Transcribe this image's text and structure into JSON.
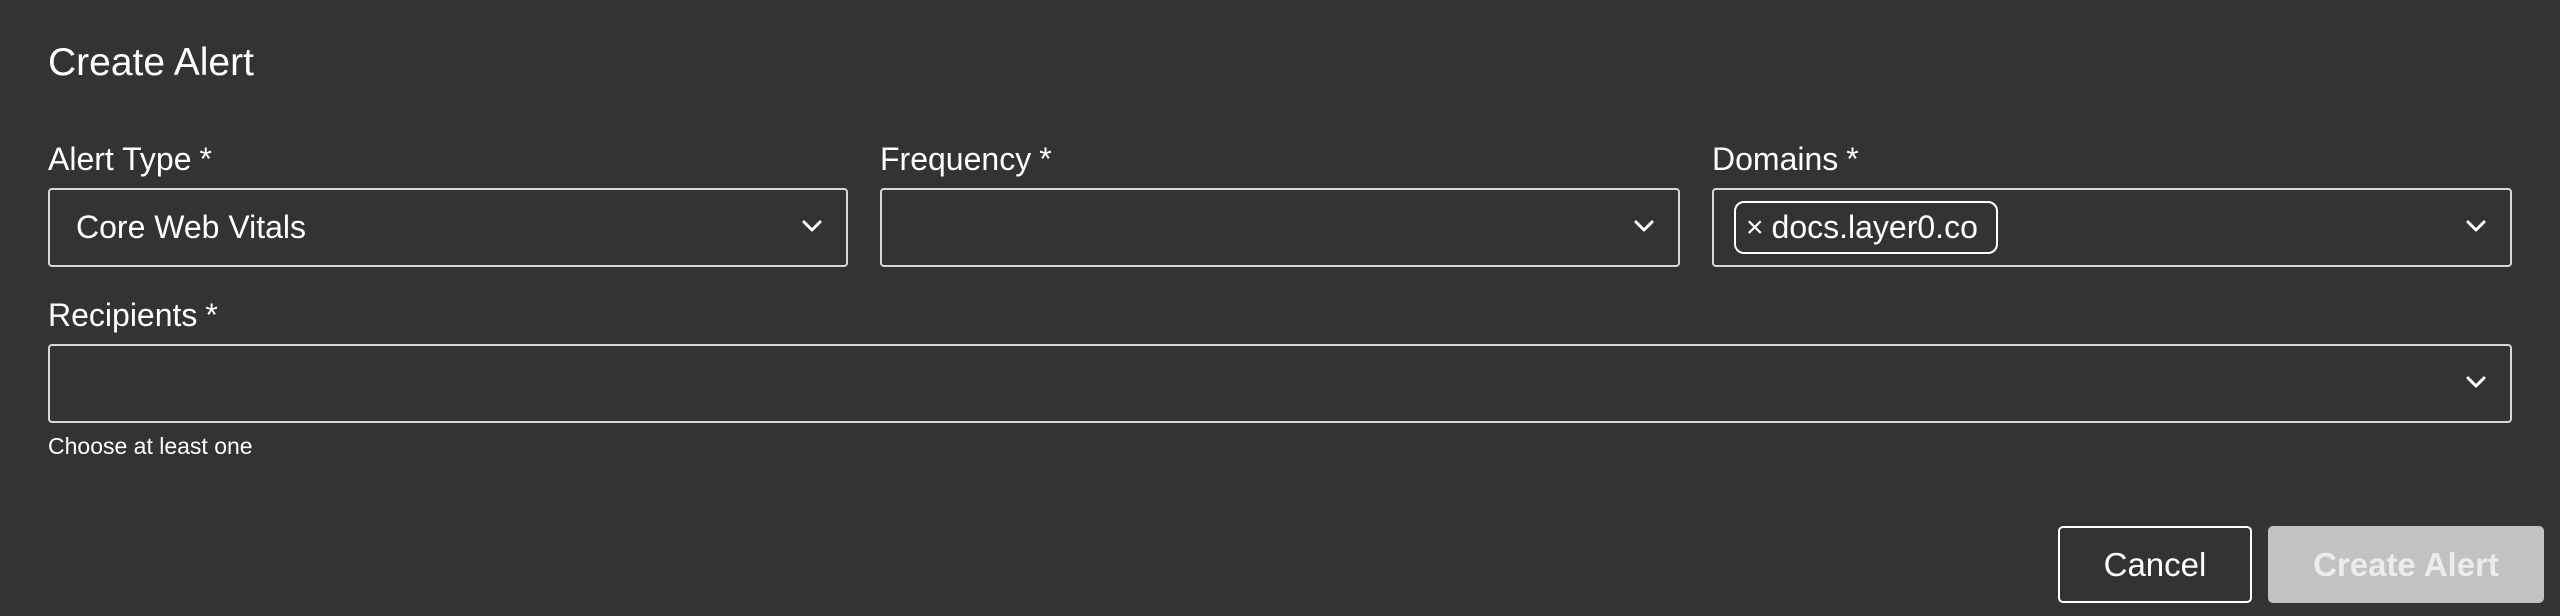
{
  "dialog": {
    "title": "Create Alert"
  },
  "fields": {
    "alert_type": {
      "label": "Alert Type",
      "required_mark": "*",
      "value": "Core Web Vitals"
    },
    "frequency": {
      "label": "Frequency",
      "required_mark": "*",
      "value": ""
    },
    "domains": {
      "label": "Domains",
      "required_mark": "*",
      "chips": [
        {
          "remove_glyph": "×",
          "label": "docs.layer0.co"
        }
      ]
    },
    "recipients": {
      "label": "Recipients",
      "required_mark": "*",
      "value": "",
      "helper_text": "Choose at least one"
    }
  },
  "actions": {
    "cancel_label": "Cancel",
    "create_label": "Create Alert"
  },
  "icons": {
    "dropdown": "chevron-down-icon",
    "chip_remove": "close-icon"
  },
  "colors": {
    "background": "#333333",
    "border": "#d8d8d8",
    "text": "#ffffff",
    "disabled_button_bg": "#c2c2c2"
  }
}
